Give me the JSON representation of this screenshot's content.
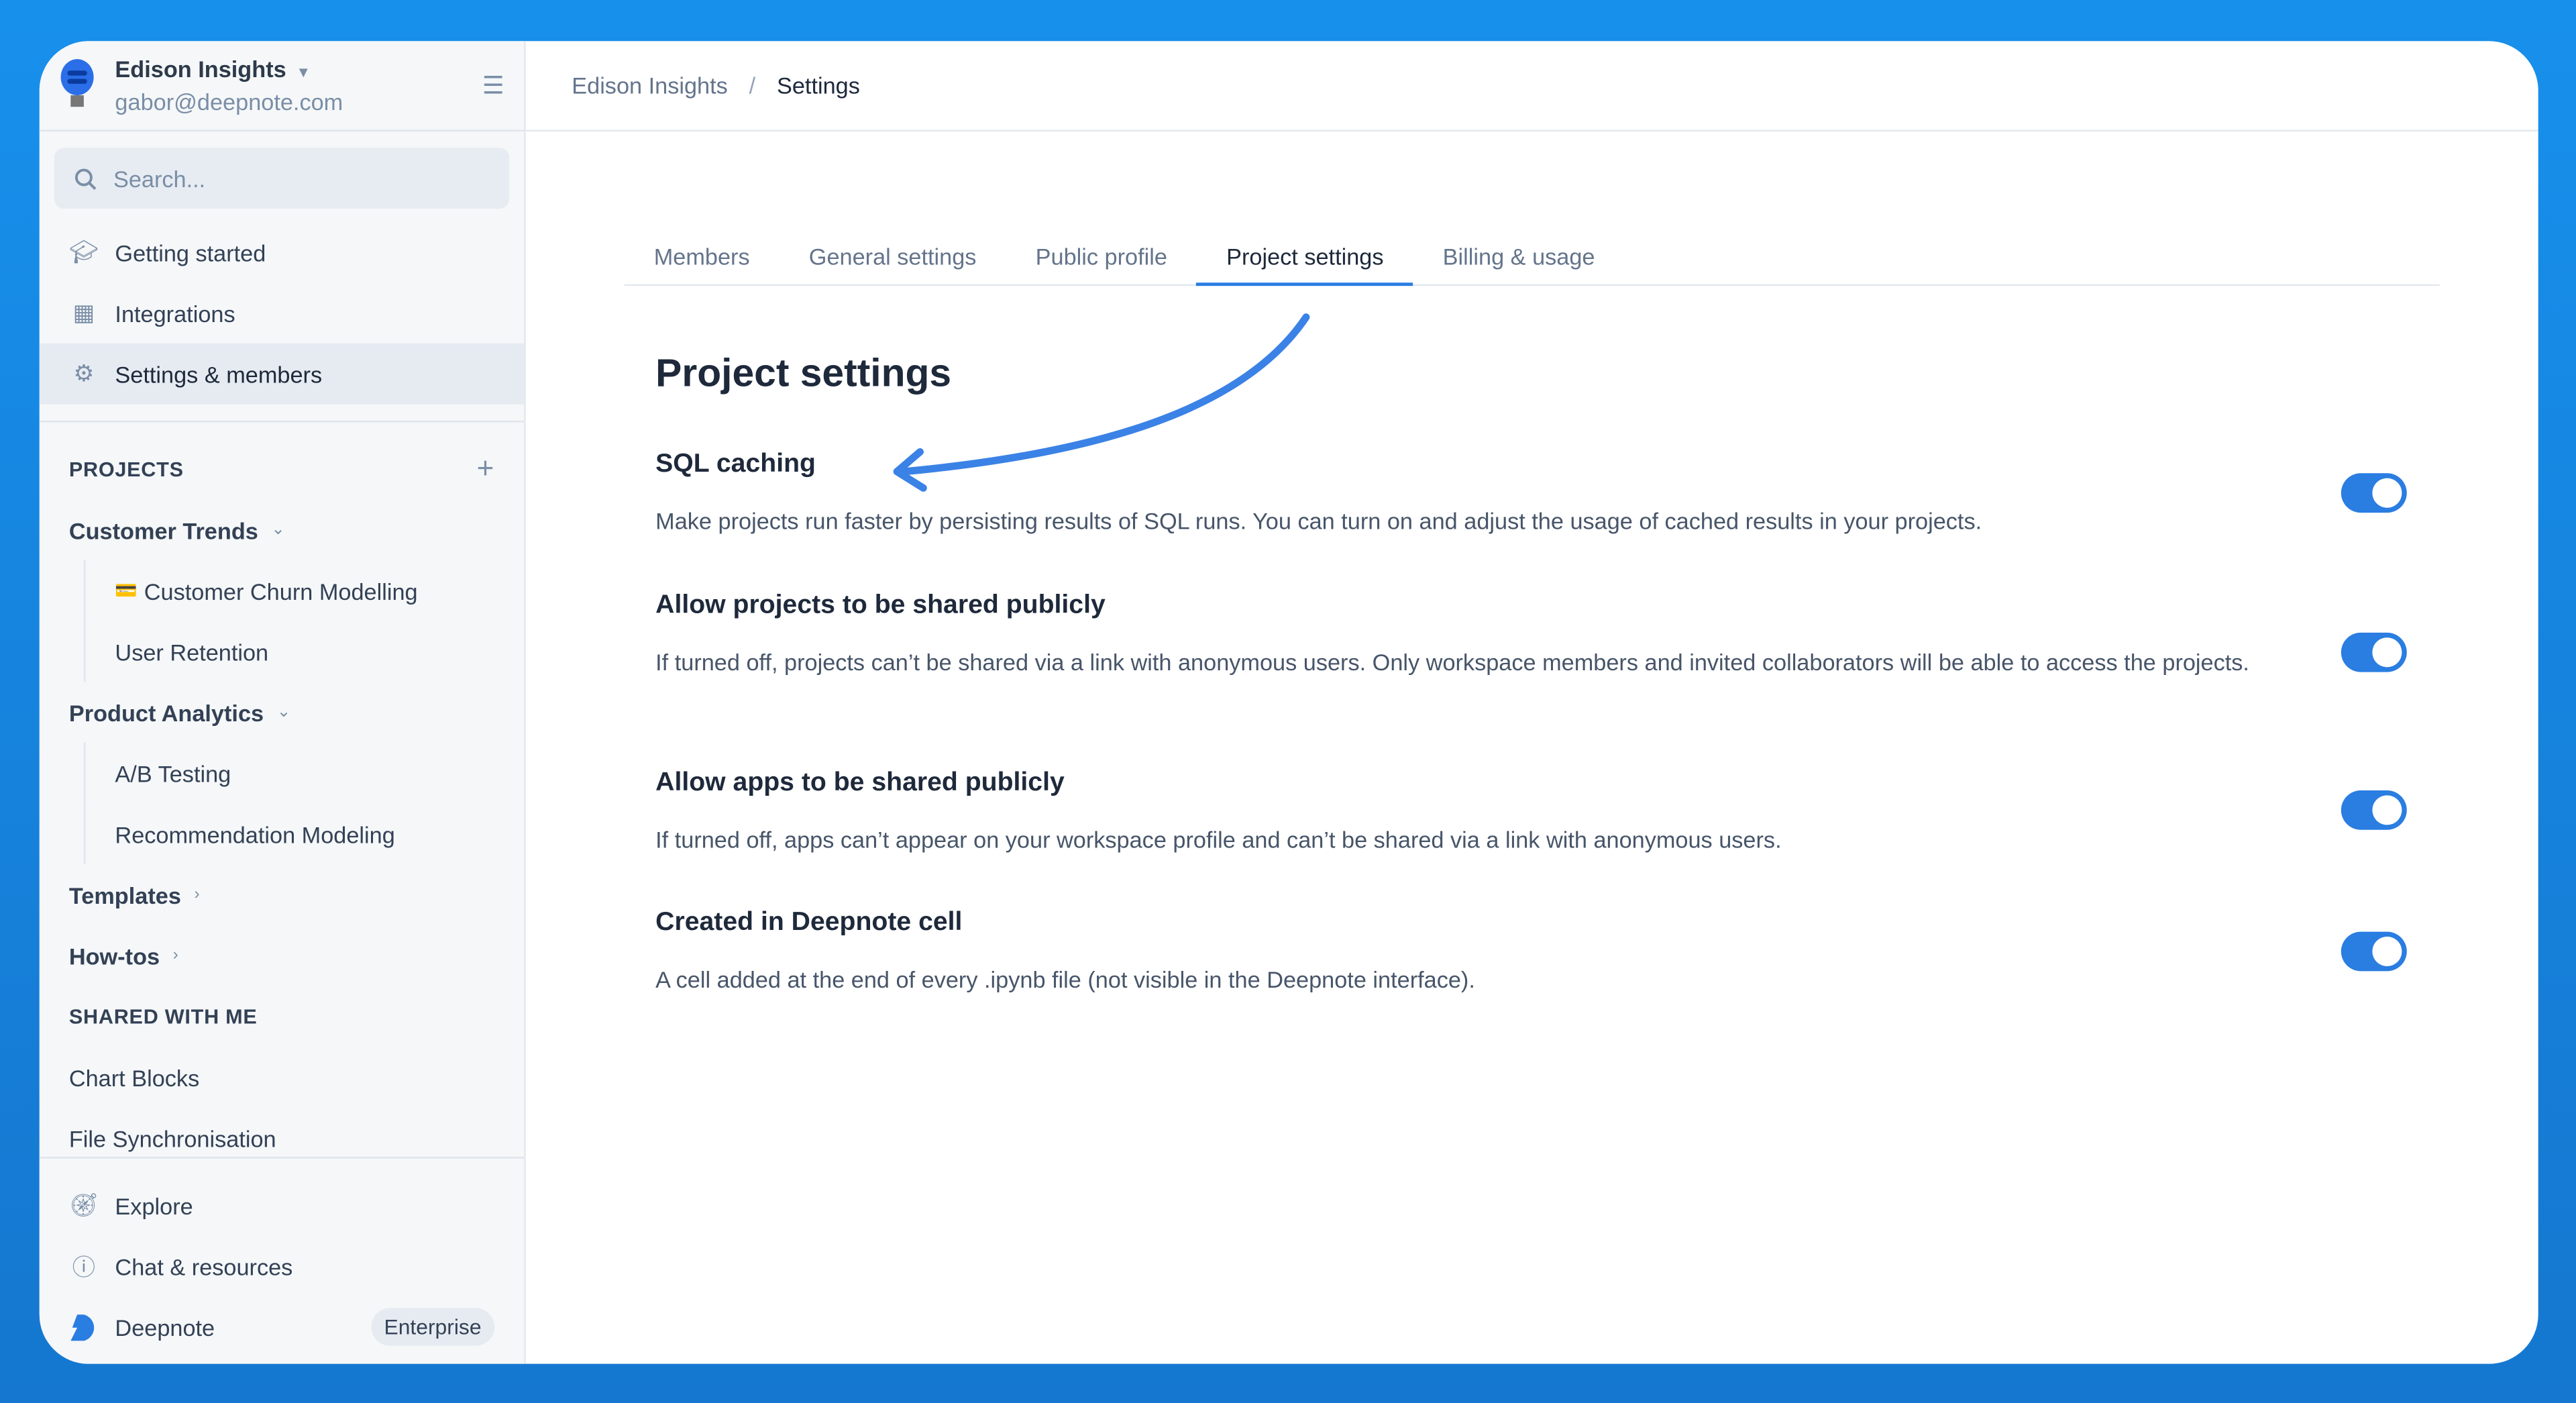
{
  "workspace": {
    "name": "Edison Insights",
    "email": "gabor@deepnote.com"
  },
  "search": {
    "placeholder": "Search..."
  },
  "nav": [
    {
      "label": "Getting started",
      "icon": "graduation-cap-icon"
    },
    {
      "label": "Integrations",
      "icon": "grid-icon"
    },
    {
      "label": "Settings & members",
      "icon": "gear-icon"
    }
  ],
  "projects": {
    "title": "PROJECTS",
    "groups": [
      {
        "label": "Customer Trends",
        "items": [
          "Customer Churn Modelling",
          "User Retention"
        ]
      },
      {
        "label": "Product Analytics",
        "items": [
          "A/B Testing",
          "Recommendation Modeling"
        ]
      }
    ],
    "templates": "Templates",
    "howtos": "How-tos"
  },
  "shared": {
    "title": "SHARED WITH ME",
    "items": [
      "Chart Blocks",
      "File Synchronisation"
    ]
  },
  "bottom": {
    "explore": "Explore",
    "chat": "Chat & resources",
    "deepnote": "Deepnote",
    "plan": "Enterprise"
  },
  "breadcrumb": [
    "Edison Insights",
    "Settings"
  ],
  "tabs": [
    "Members",
    "General settings",
    "Public profile",
    "Project settings",
    "Billing & usage"
  ],
  "page_title": "Project settings",
  "settings": [
    {
      "title": "SQL caching",
      "desc": "Make projects run faster by persisting results of SQL runs. You can turn on and adjust the usage of cached results in your projects.",
      "enabled": true
    },
    {
      "title": "Allow projects to be shared publicly",
      "desc": "If turned off, projects can’t be shared via a link with anonymous users. Only workspace members and invited collaborators will be able to access the projects.",
      "enabled": true
    },
    {
      "title": "Allow apps to be shared publicly",
      "desc": "If turned off, apps can’t appear on your workspace profile and can’t be shared via a link with anonymous users.",
      "enabled": true
    },
    {
      "title": "Created in Deepnote cell",
      "desc": "A cell added at the end of every .ipynb file (not visible in the Deepnote interface).",
      "enabled": true
    }
  ],
  "colors": {
    "accent": "#2a7de1",
    "background": "#1790ec"
  }
}
